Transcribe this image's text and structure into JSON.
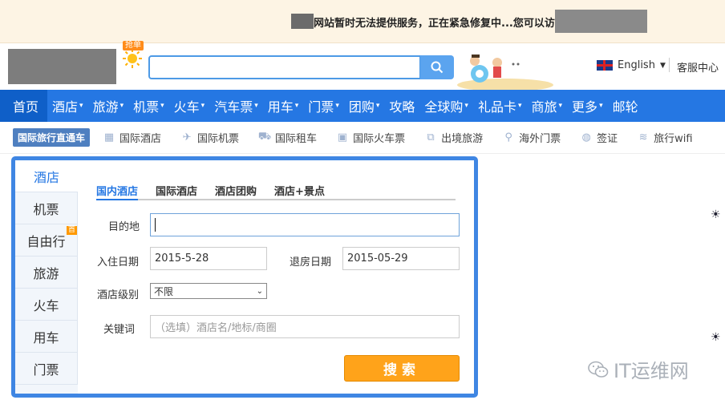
{
  "notice": {
    "message": "网站暂时无法提供服务，正在紧急修复中...您可以访问："
  },
  "header": {
    "search": {
      "value": ""
    },
    "grab_tag": "抢单",
    "language": "English",
    "service": "客服中心"
  },
  "nav": [
    {
      "label": "首页",
      "caret": ""
    },
    {
      "label": "酒店",
      "caret": "▾"
    },
    {
      "label": "旅游",
      "caret": "▾"
    },
    {
      "label": "机票",
      "caret": "▾"
    },
    {
      "label": "火车",
      "caret": "▾"
    },
    {
      "label": "汽车票",
      "caret": "▾"
    },
    {
      "label": "用车",
      "caret": "▾"
    },
    {
      "label": "门票",
      "caret": "▾"
    },
    {
      "label": "团购",
      "caret": "▾"
    },
    {
      "label": "攻略",
      "caret": ""
    },
    {
      "label": "全球购",
      "caret": "▾"
    },
    {
      "label": "礼品卡",
      "caret": "▾"
    },
    {
      "label": "商旅",
      "caret": "▾"
    },
    {
      "label": "更多",
      "caret": "▾"
    },
    {
      "label": "邮轮",
      "caret": ""
    }
  ],
  "subnav": {
    "direct_label": "国际旅行直通车",
    "items": [
      {
        "icon": "building-icon",
        "glyph": "▦",
        "label": "国际酒店"
      },
      {
        "icon": "plane-icon",
        "glyph": "✈",
        "label": "国际机票"
      },
      {
        "icon": "car-icon",
        "glyph": "⛟",
        "label": "国际租车"
      },
      {
        "icon": "train-icon",
        "glyph": "▣",
        "label": "国际火车票"
      },
      {
        "icon": "suitcase-icon",
        "glyph": "⧉",
        "label": "出境旅游"
      },
      {
        "icon": "location-pin-icon",
        "glyph": "⚲",
        "label": "海外门票"
      },
      {
        "icon": "globe-icon",
        "glyph": "◍",
        "label": "签证"
      },
      {
        "icon": "wifi-icon",
        "glyph": "≋",
        "label": "旅行wifi"
      }
    ]
  },
  "booking": {
    "vtabs": [
      "酒店",
      "机票",
      "自由行",
      "旅游",
      "火车",
      "用车",
      "门票"
    ],
    "first_badge": "首",
    "htabs": [
      "国内酒店",
      "国际酒店",
      "酒店团购",
      "酒店+景点"
    ],
    "destination_label": "目的地",
    "checkin_label": "入住日期",
    "checkin_value": "2015-5-28",
    "checkout_label": "退房日期",
    "checkout_value": "2015-05-29",
    "level_label": "酒店级别",
    "level_value": "不限",
    "keyword_label": "关键词",
    "keyword_placeholder": "（选填）酒店名/地标/商圈",
    "search_label": "搜索"
  },
  "watermark": {
    "text": "IT运维网"
  }
}
